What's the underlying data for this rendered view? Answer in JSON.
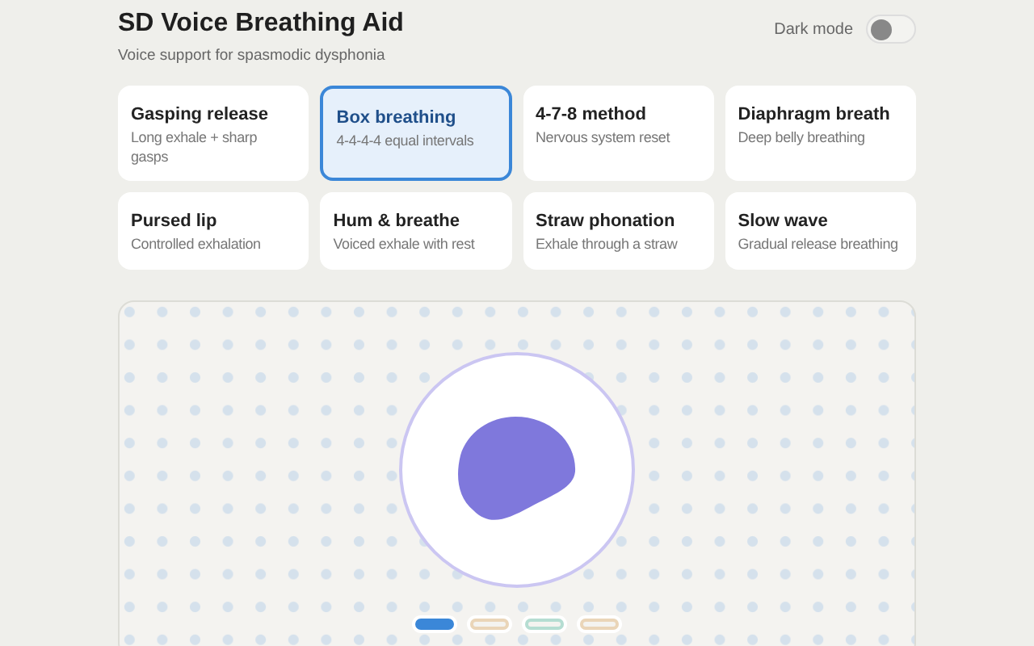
{
  "header": {
    "title": "SD Voice Breathing Aid",
    "subtitle": "Voice support for spasmodic dysphonia"
  },
  "dark_mode": {
    "label": "Dark mode",
    "on": false
  },
  "techniques": [
    {
      "name": "Gasping release",
      "description": "Long exhale + sharp gasps",
      "selected": false
    },
    {
      "name": "Box breathing",
      "description": "4-4-4-4 equal intervals",
      "selected": true
    },
    {
      "name": "4-7-8 method",
      "description": "Nervous system reset",
      "selected": false
    },
    {
      "name": "Diaphragm breath",
      "description": "Deep belly breathing",
      "selected": false
    },
    {
      "name": "Pursed lip",
      "description": "Controlled exhalation",
      "selected": false
    },
    {
      "name": "Hum & breathe",
      "description": "Voiced exhale with rest",
      "selected": false
    },
    {
      "name": "Straw phonation",
      "description": "Exhale through a straw",
      "selected": false
    },
    {
      "name": "Slow wave",
      "description": "Gradual release breathing",
      "selected": false
    }
  ],
  "phases": [
    {
      "selected": true,
      "color": "#3b87d8"
    },
    {
      "selected": false,
      "color": "#ead5b8"
    },
    {
      "selected": false,
      "color": "#b5ddd2"
    },
    {
      "selected": false,
      "color": "#ead5b8"
    }
  ]
}
